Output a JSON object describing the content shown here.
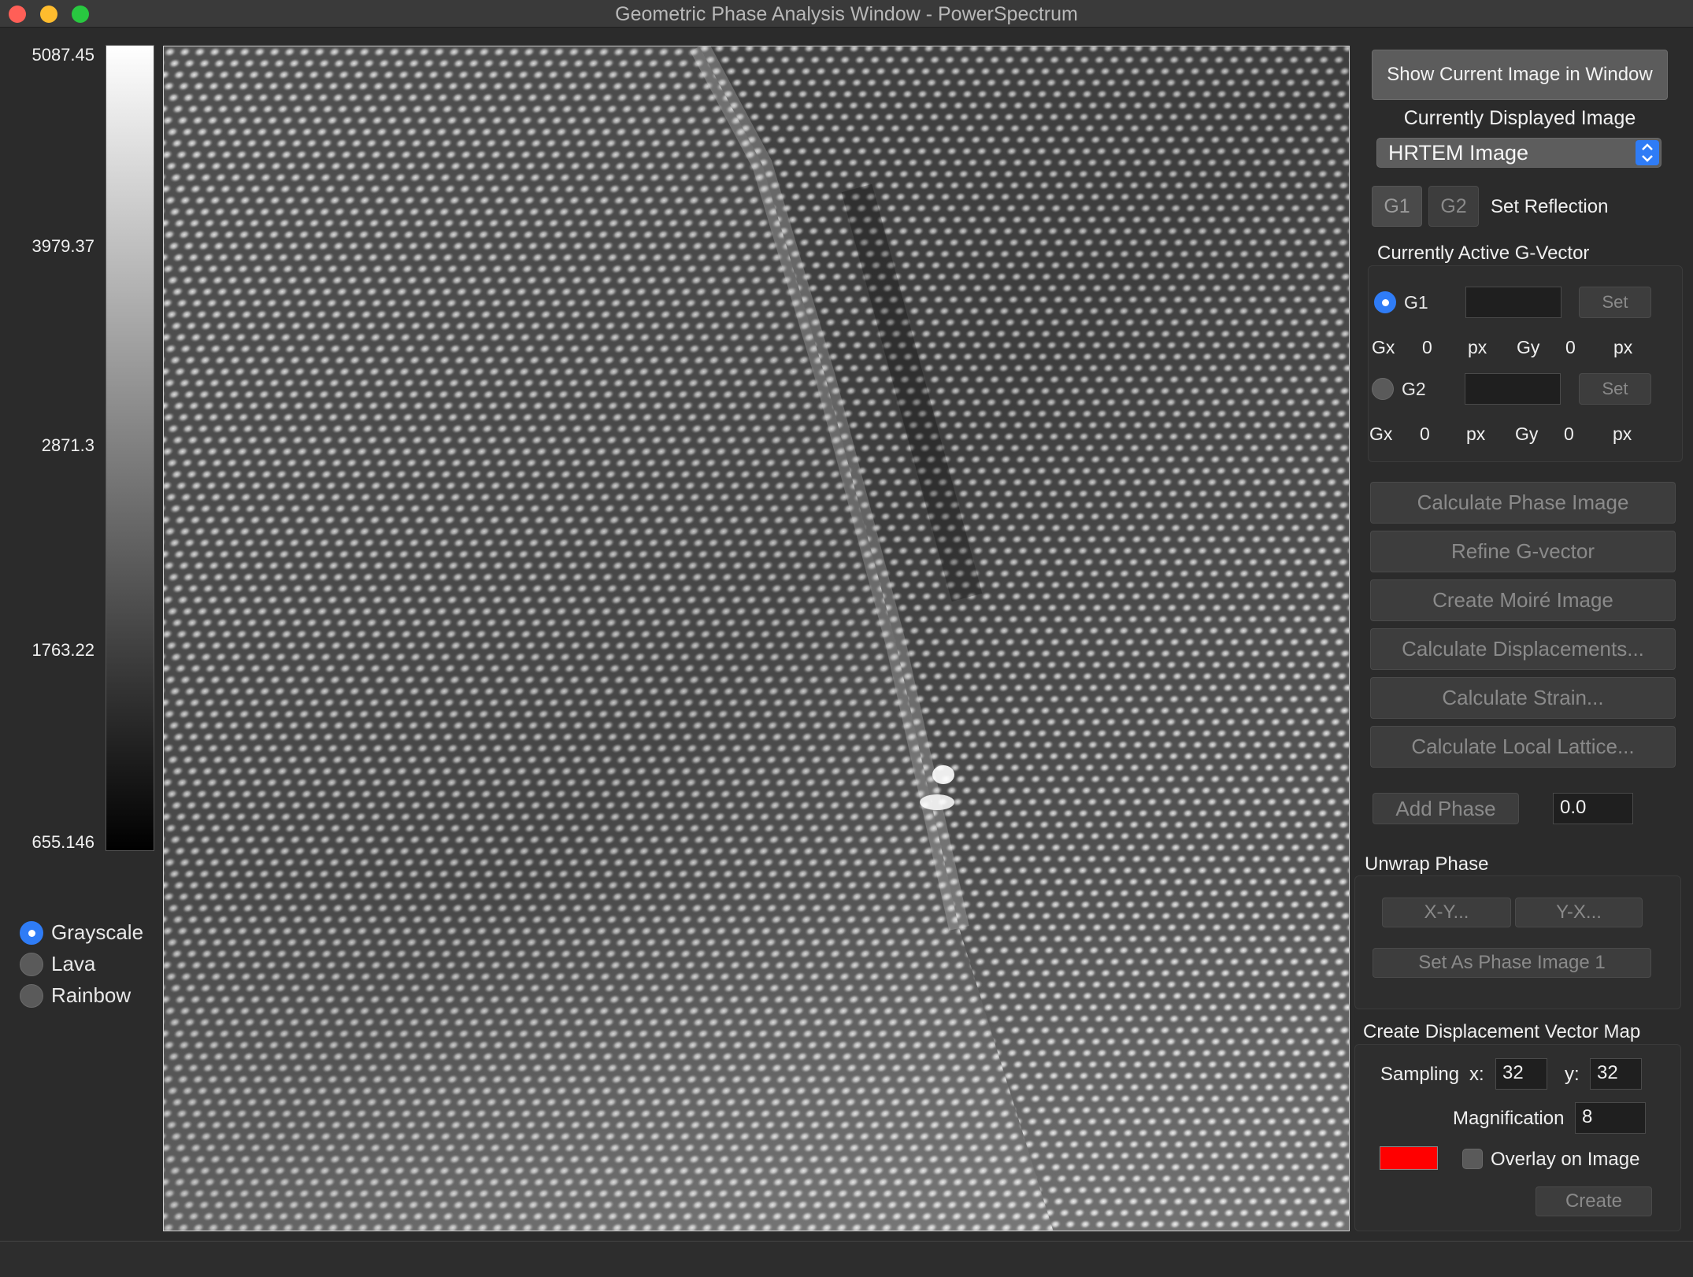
{
  "window": {
    "title": "Geometric Phase Analysis Window - PowerSpectrum"
  },
  "colorbar": {
    "labels": [
      "5087.45",
      "3979.37",
      "2871.3",
      "1763.22",
      "655.146"
    ]
  },
  "colormap": {
    "options": [
      {
        "label": "Grayscale",
        "selected": true
      },
      {
        "label": "Lava",
        "selected": false
      },
      {
        "label": "Rainbow",
        "selected": false
      }
    ]
  },
  "panel": {
    "show_image_button": "Show Current Image in Window",
    "displayed_image_label": "Currently Displayed Image",
    "displayed_image_value": "HRTEM Image",
    "reflection": {
      "g1": "G1",
      "g2": "G2",
      "label": "Set Reflection"
    },
    "active_gvector": {
      "heading": "Currently Active G-Vector",
      "g1": {
        "label": "G1",
        "selected": true,
        "set": "Set",
        "gx_label": "Gx",
        "gx": "0",
        "gy_label": "Gy",
        "gy": "0",
        "unit": "px"
      },
      "g2": {
        "label": "G2",
        "selected": false,
        "set": "Set",
        "gx_label": "Gx",
        "gx": "0",
        "gy_label": "Gy",
        "gy": "0",
        "unit": "px"
      }
    },
    "actions": [
      "Calculate Phase Image",
      "Refine G-vector",
      "Create Moiré Image",
      "Calculate Displacements...",
      "Calculate Strain...",
      "Calculate Local Lattice..."
    ],
    "add_phase": {
      "button": "Add Phase",
      "value": "0.0"
    },
    "unwrap": {
      "heading": "Unwrap Phase",
      "xy": "X-Y...",
      "yx": "Y-X...",
      "set_phase": "Set As Phase Image 1"
    },
    "displacement_map": {
      "heading": "Create Displacement Vector Map",
      "sampling_label": "Sampling",
      "x_label": "x:",
      "x_value": "32",
      "y_label": "y:",
      "y_value": "32",
      "magnification_label": "Magnification",
      "magnification_value": "8",
      "swatch_color": "#ff0000",
      "overlay_label": "Overlay on Image",
      "create_button": "Create"
    }
  }
}
